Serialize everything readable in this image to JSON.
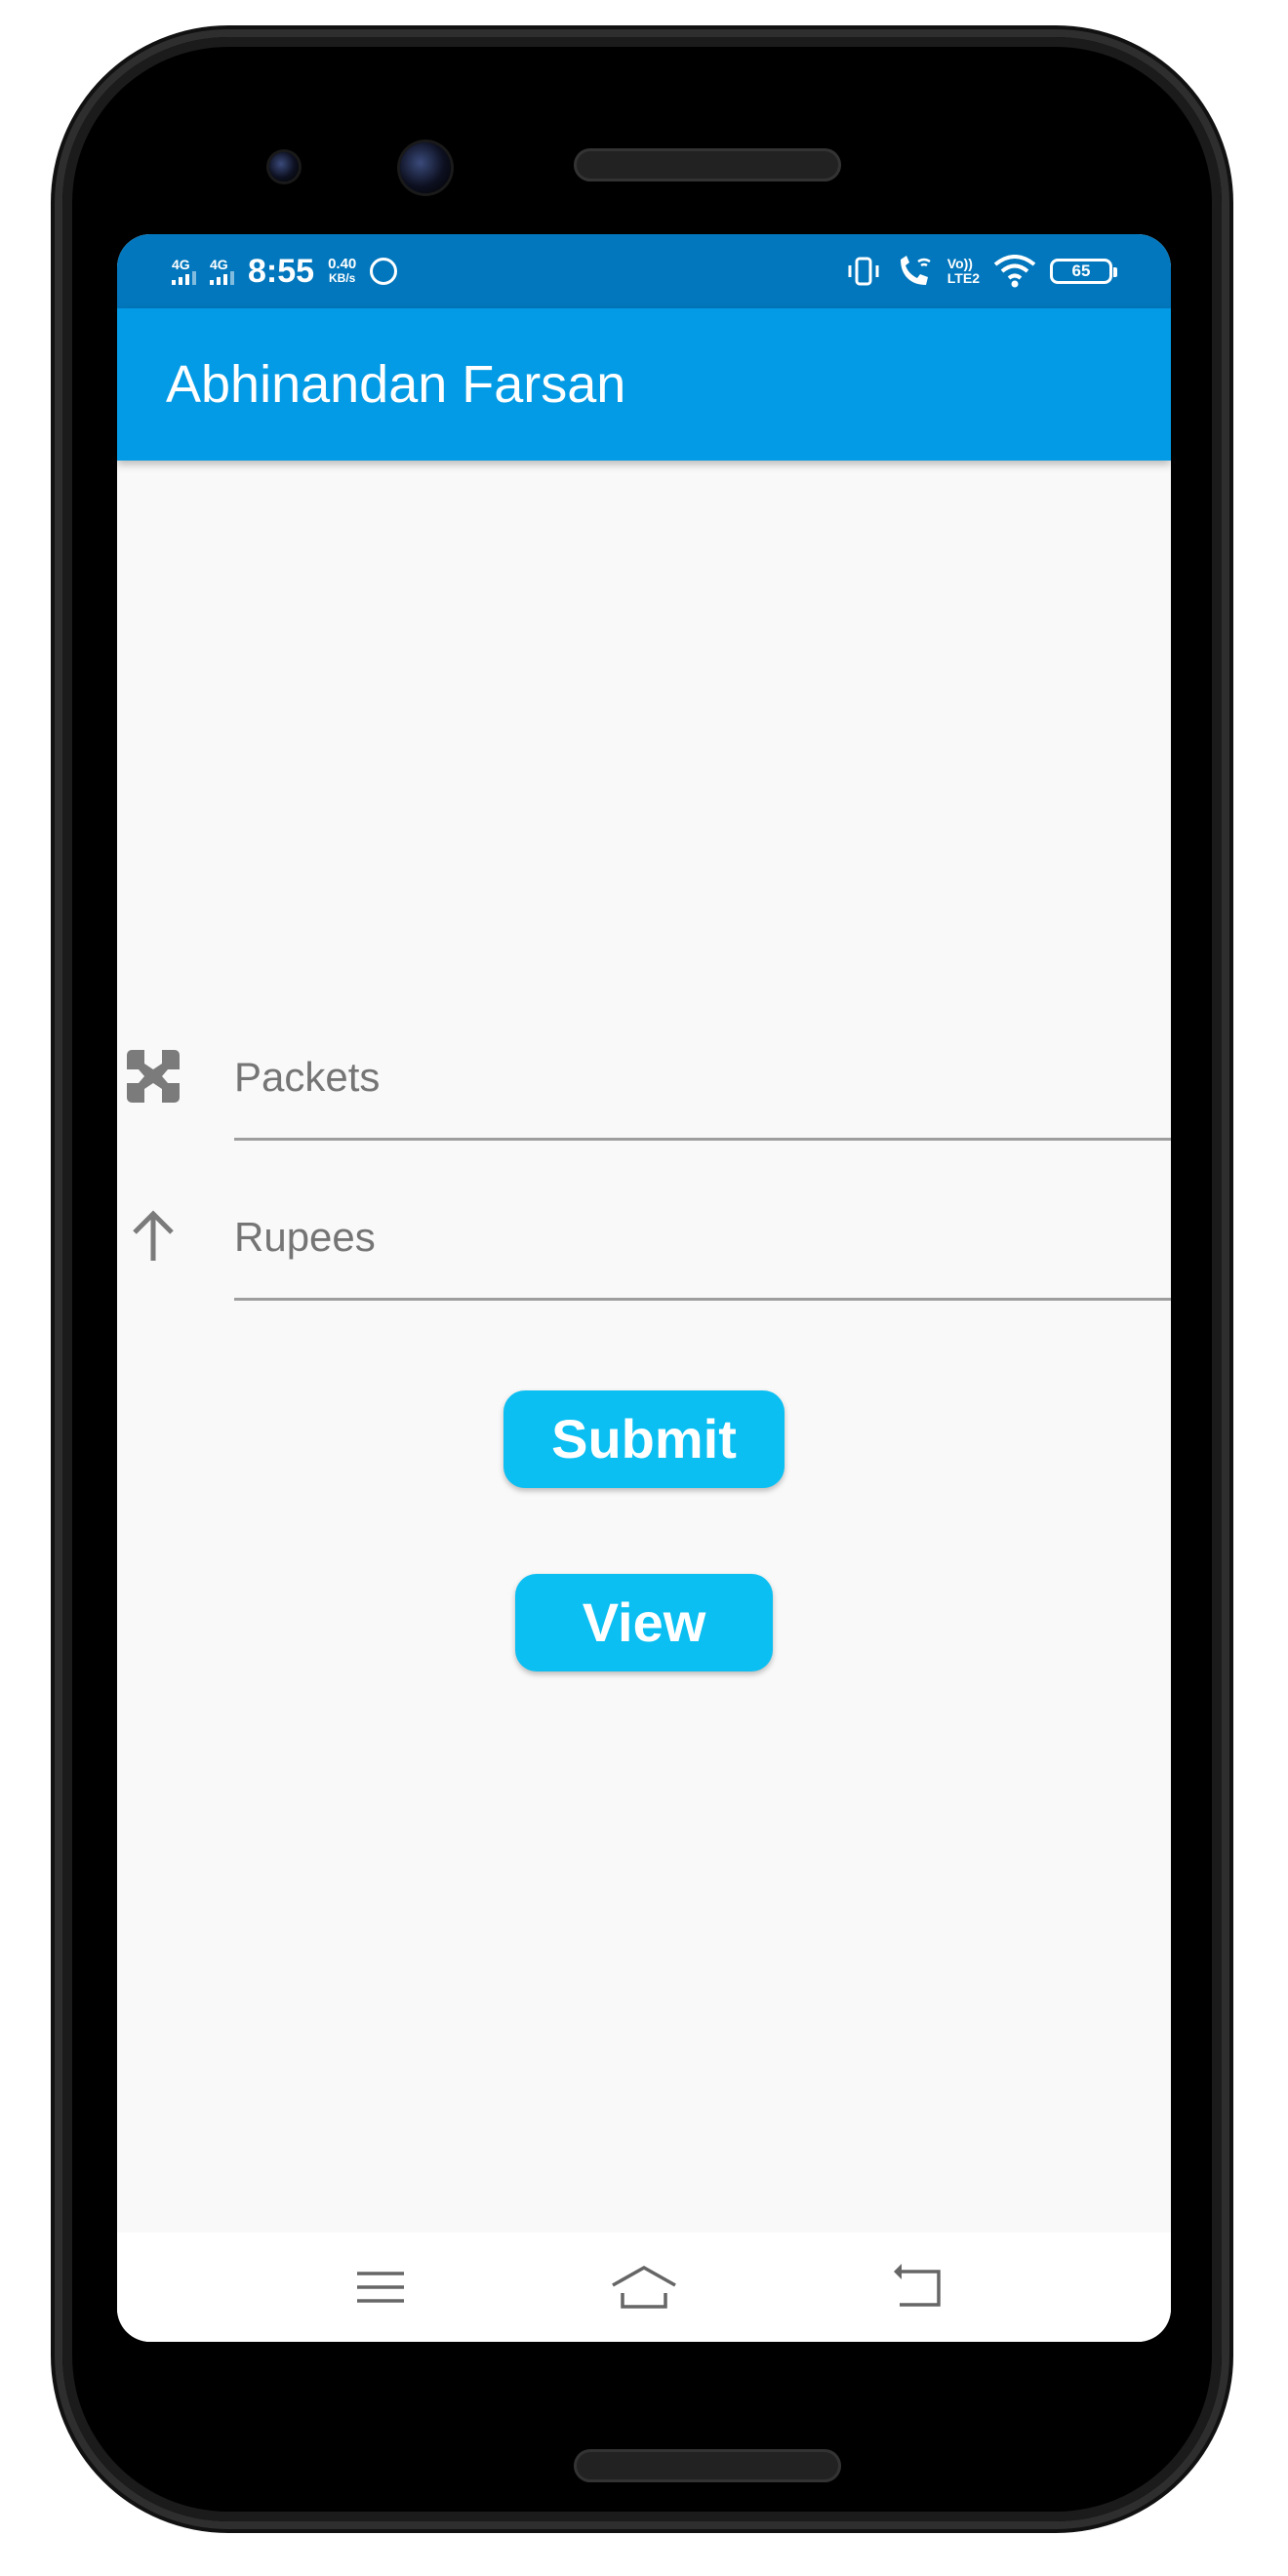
{
  "statusbar": {
    "sim1": "4G",
    "sim2": "4G",
    "time": "8:55",
    "speed_value": "0.40",
    "speed_unit": "KB/s",
    "volte": "Vo))",
    "lte": "LTE2",
    "battery": "65"
  },
  "appbar": {
    "title": "Abhinandan Farsan"
  },
  "form": {
    "packets_placeholder": "Packets",
    "rupees_placeholder": "Rupees"
  },
  "buttons": {
    "submit": "Submit",
    "view": "View"
  },
  "colors": {
    "statusbar": "#0277bd",
    "appbar": "#039be5",
    "button": "#0bbff2",
    "background": "#f9f9f9"
  },
  "icons": {
    "packets": "package-icon",
    "rupees": "arrow-up-icon",
    "nav": [
      "menu-icon",
      "home-icon",
      "back-icon"
    ]
  }
}
